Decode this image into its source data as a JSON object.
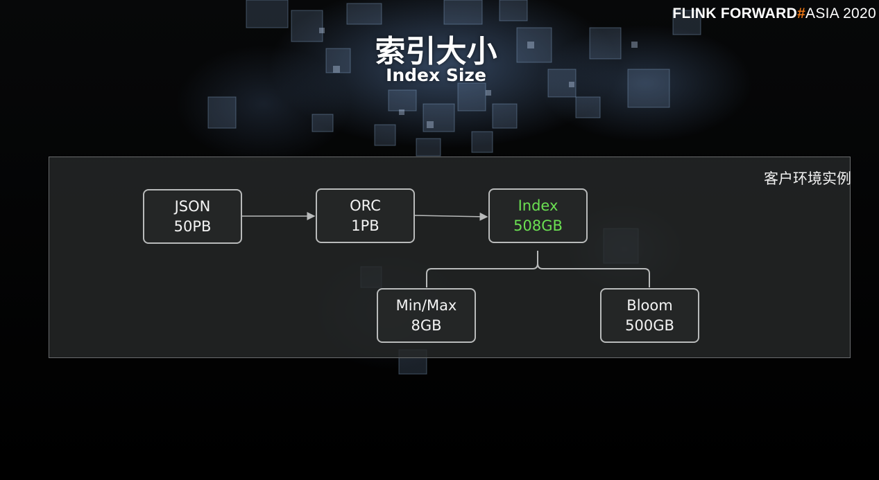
{
  "brand": {
    "part1": "FLINK FORWARD",
    "hash": "#",
    "part2": "ASIA 2020"
  },
  "title": {
    "zh": "索引大小",
    "en": "Index Size"
  },
  "panel": {
    "label": "客户环境实例"
  },
  "nodes": {
    "json": {
      "name": "JSON",
      "size": "50PB"
    },
    "orc": {
      "name": "ORC",
      "size": "1PB"
    },
    "index": {
      "name": "Index",
      "size": "508GB"
    },
    "minmax": {
      "name": "Min/Max",
      "size": "8GB"
    },
    "bloom": {
      "name": "Bloom",
      "size": "500GB"
    }
  },
  "colors": {
    "highlight": "#6be052",
    "brand_hash": "#f07814",
    "node_border": "#b9bbbb"
  }
}
